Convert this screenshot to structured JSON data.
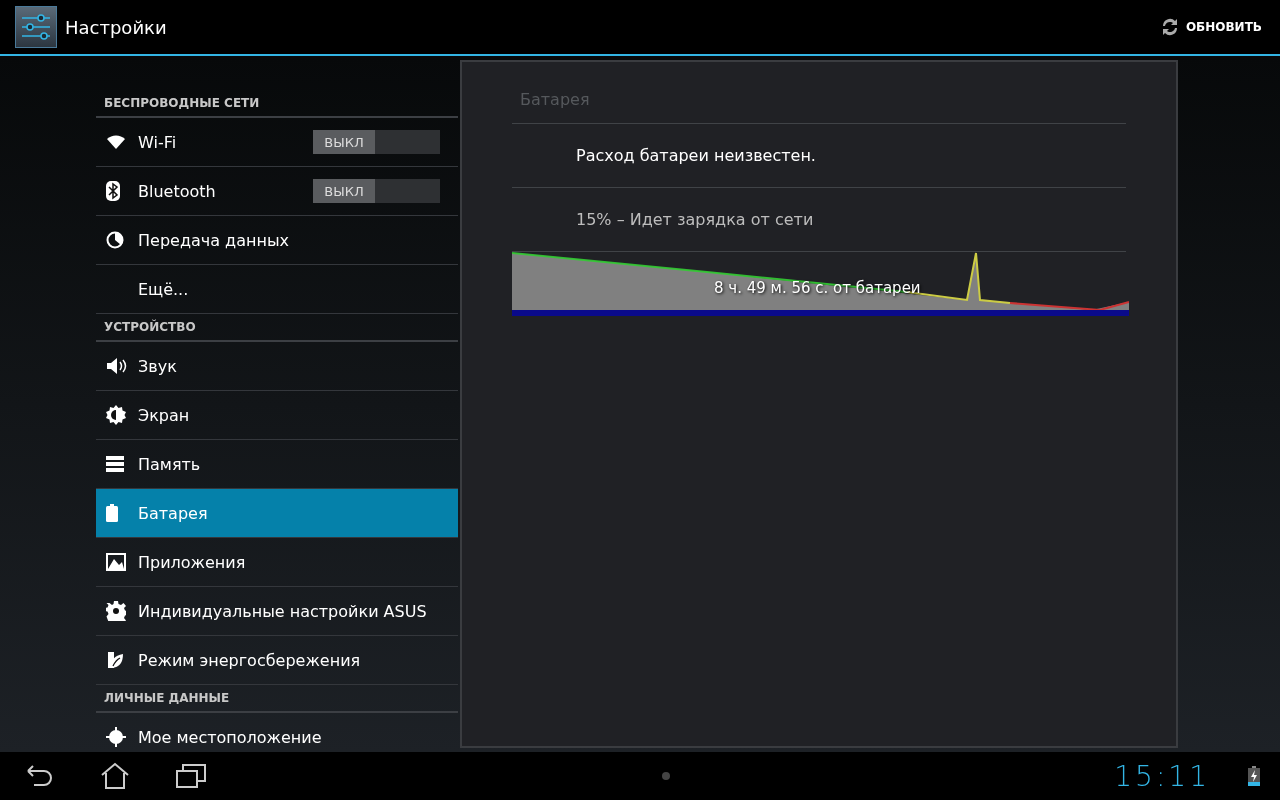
{
  "action_bar": {
    "title": "Настройки",
    "refresh_label": "ОБНОВИТЬ"
  },
  "sidebar": {
    "sections": [
      {
        "header": "БЕСПРОВОДНЫЕ СЕТИ",
        "items": [
          {
            "label": "Wi-Fi",
            "selected": false,
            "switch": {
              "label": "ВЫКЛ",
              "on": false
            }
          },
          {
            "label": "Bluetooth",
            "selected": false,
            "switch": {
              "label": "ВЫКЛ",
              "on": false
            }
          },
          {
            "label": "Передача данных",
            "selected": false
          },
          {
            "label": "Ещё...",
            "selected": false
          }
        ]
      },
      {
        "header": "УСТРОЙСТВО",
        "items": [
          {
            "label": "Звук",
            "selected": false
          },
          {
            "label": "Экран",
            "selected": false
          },
          {
            "label": "Память",
            "selected": false
          },
          {
            "label": "Батарея",
            "selected": true
          },
          {
            "label": "Приложения",
            "selected": false
          },
          {
            "label": "Индивидуальные настройки ASUS",
            "selected": false
          },
          {
            "label": "Режим энергосбережения",
            "selected": false
          }
        ]
      },
      {
        "header": "ЛИЧНЫЕ ДАННЫЕ",
        "items": [
          {
            "label": "Мое местоположение",
            "selected": false
          }
        ]
      }
    ]
  },
  "detail": {
    "title": "Батарея",
    "usage_note": "Расход батареи неизвестен.",
    "status": "15% – Идет зарядка от сети",
    "graph_label": "8 ч. 49 м. 56 с. от батареи"
  },
  "nav_bar": {
    "time": "15:11"
  }
}
